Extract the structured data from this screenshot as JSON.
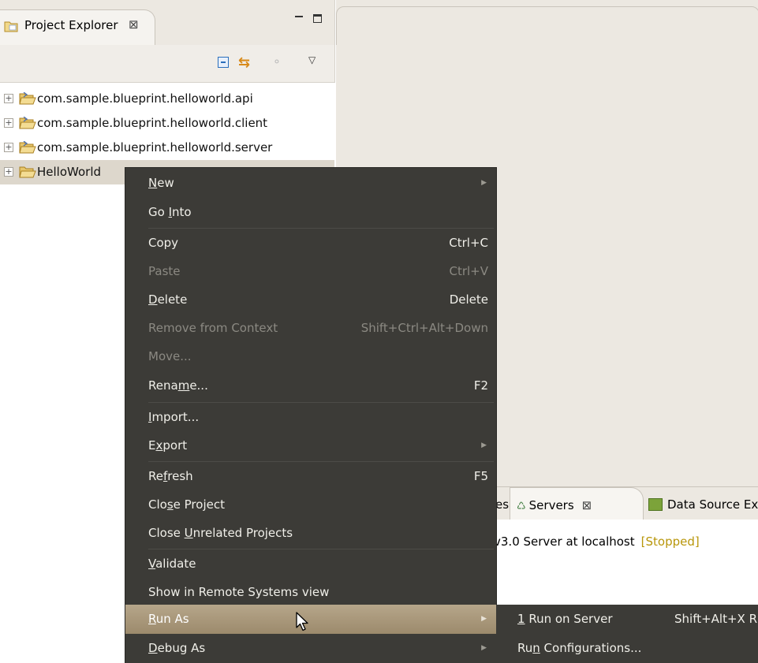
{
  "project_explorer": {
    "tab_title": "Project Explorer",
    "tab_close": "⊠",
    "tree": [
      {
        "label": "com.sample.blueprint.helloworld.api",
        "expander": "+"
      },
      {
        "label": "com.sample.blueprint.helloworld.client",
        "expander": "+"
      },
      {
        "label": "com.sample.blueprint.helloworld.server",
        "expander": "+"
      },
      {
        "label": "HelloWorld",
        "expander": "+",
        "selected": true
      }
    ]
  },
  "bottom_panel": {
    "partial_tab": "es",
    "servers_tab": "Servers",
    "servers_close": "⊠",
    "datasource_tab": "Data Source Expl",
    "server_row": "v3.0 Server at localhost",
    "server_status": "[Stopped]"
  },
  "context_menu": {
    "items": [
      {
        "pre": "",
        "u": "N",
        "post": "ew",
        "accel": "",
        "submenu": true,
        "disabled": false
      },
      {
        "pre": "Go ",
        "u": "I",
        "post": "nto",
        "accel": "",
        "submenu": false,
        "disabled": false
      },
      {
        "pre": "Copy",
        "u": "",
        "post": "",
        "accel": "Ctrl+C",
        "submenu": false,
        "disabled": false
      },
      {
        "pre": "Paste",
        "u": "",
        "post": "",
        "accel": "Ctrl+V",
        "submenu": false,
        "disabled": true
      },
      {
        "pre": "",
        "u": "D",
        "post": "elete",
        "accel": "Delete",
        "submenu": false,
        "disabled": false
      },
      {
        "pre": "Remove from Context",
        "u": "",
        "post": "",
        "accel": "Shift+Ctrl+Alt+Down",
        "submenu": false,
        "disabled": true
      },
      {
        "pre": "Move...",
        "u": "",
        "post": "",
        "accel": "",
        "submenu": false,
        "disabled": true
      },
      {
        "pre": "Rena",
        "u": "m",
        "post": "e...",
        "accel": "F2",
        "submenu": false,
        "disabled": false
      },
      {
        "pre": "",
        "u": "I",
        "post": "mport...",
        "accel": "",
        "submenu": false,
        "disabled": false
      },
      {
        "pre": "E",
        "u": "x",
        "post": "port",
        "accel": "",
        "submenu": true,
        "disabled": false
      },
      {
        "pre": "Re",
        "u": "f",
        "post": "resh",
        "accel": "F5",
        "submenu": false,
        "disabled": false
      },
      {
        "pre": "Clo",
        "u": "s",
        "post": "e Project",
        "accel": "",
        "submenu": false,
        "disabled": false
      },
      {
        "pre": "Close ",
        "u": "U",
        "post": "nrelated Projects",
        "accel": "",
        "submenu": false,
        "disabled": false
      },
      {
        "pre": "",
        "u": "V",
        "post": "alidate",
        "accel": "",
        "submenu": false,
        "disabled": false
      },
      {
        "pre": "Show in Remote Systems view",
        "u": "",
        "post": "",
        "accel": "",
        "submenu": false,
        "disabled": false
      },
      {
        "pre": "",
        "u": "R",
        "post": "un As",
        "accel": "",
        "submenu": true,
        "disabled": false,
        "highlighted": true
      },
      {
        "pre": "",
        "u": "D",
        "post": "ebug As",
        "accel": "",
        "submenu": true,
        "disabled": false
      }
    ]
  },
  "run_as_submenu": {
    "items": [
      {
        "pre": "",
        "u": "1",
        "post": " Run on Server",
        "accel": "Shift+Alt+X R"
      },
      {
        "pre": "Ru",
        "u": "n",
        "post": " Configurations...",
        "accel": ""
      }
    ]
  },
  "colors": {
    "menu_bg": "#3c3b37",
    "menu_highlight": "#a89878",
    "selection": "#ddd7cc",
    "status_stopped": "#b8960a"
  }
}
